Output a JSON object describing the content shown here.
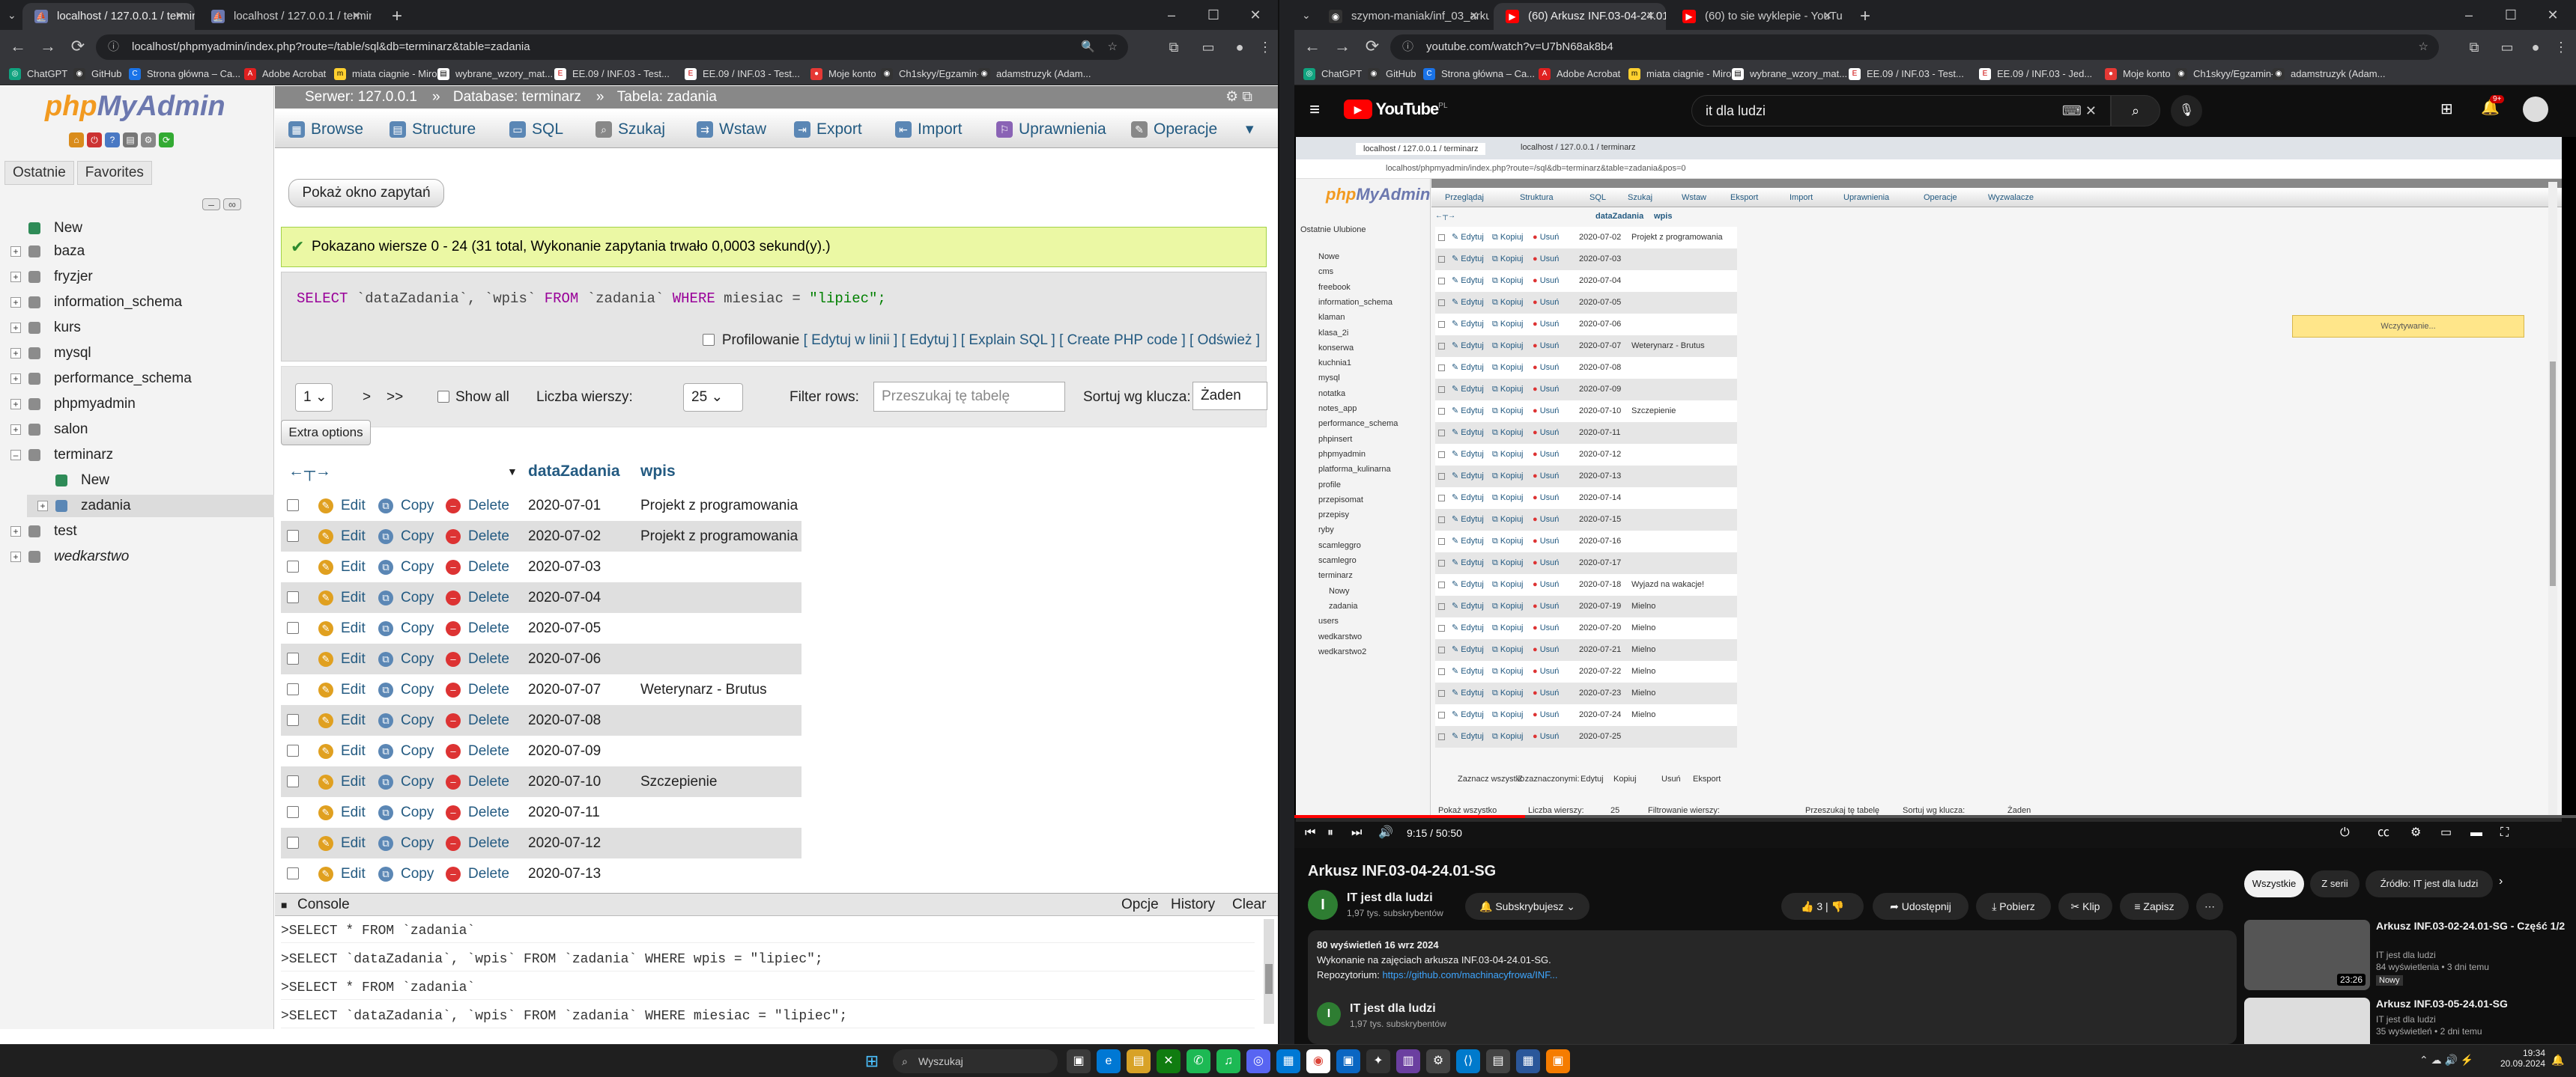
{
  "left_browser": {
    "tabs": [
      {
        "title": "localhost / 127.0.0.1 / terminarz"
      },
      {
        "title": "localhost / 127.0.0.1 / terminarz"
      }
    ],
    "url": "localhost/phpmyadmin/index.php?route=/table/sql&db=terminarz&table=zadania",
    "bookmarks": [
      "ChatGPT",
      "GitHub",
      "Strona główna – Ca...",
      "Adobe Acrobat",
      "miata ciagnie - Miro",
      "wybrane_wzory_mat...",
      "EE.09 / INF.03 - Test...",
      "EE.09 / INF.03 - Test...",
      "Moje konto",
      "Ch1skyy/Egzamin-...",
      "adamstruzyk (Adam..."
    ]
  },
  "pma": {
    "logo_php": "php",
    "logo_myadmin": "MyAdmin",
    "nav_tabs": [
      "Ostatnie",
      "Favorites"
    ],
    "tree": [
      "New",
      "baza",
      "fryzjer",
      "information_schema",
      "kurs",
      "mysql",
      "performance_schema",
      "phpmyadmin",
      "salon",
      "terminarz",
      "New",
      "zadania",
      "test",
      "wedkarstwo"
    ],
    "breadcrumb": {
      "server": "Serwer: 127.0.0.1",
      "database": "Database: terminarz",
      "table": "Tabela: zadania"
    },
    "tabs": [
      "Browse",
      "Structure",
      "SQL",
      "Szukaj",
      "Wstaw",
      "Export",
      "Import",
      "Uprawnienia",
      "Operacje"
    ],
    "query_window_button": "Pokaż okno zapytań",
    "success_message": "Pokazano wiersze 0 - 24 (31 total, Wykonanie zapytania trwało 0,0003 sekund(y).)",
    "sql": {
      "select": "SELECT",
      "cols": "`dataZadania`, `wpis`",
      "from": "FROM",
      "table": "`zadania`",
      "where": "WHERE",
      "cond": "miesiac = ",
      "val": "\"lipiec\";"
    },
    "profiling": "Profilowanie",
    "sql_links": [
      "Edytuj w linii",
      "Edytuj",
      "Explain SQL",
      "Create PHP code",
      "Odśwież"
    ],
    "nav": {
      "page": "1",
      "next": ">",
      "last": ">>",
      "show_all": "Show all",
      "rows_label": "Liczba wierszy:",
      "rows_value": "25",
      "filter_label": "Filter rows:",
      "filter_placeholder": "Przeszukaj tę tabelę",
      "sort_label": "Sortuj wg klucza:",
      "sort_value": "Żaden"
    },
    "extra_options": "Extra options",
    "columns": [
      "dataZadania",
      "wpis"
    ],
    "row_actions": {
      "edit": "Edit",
      "copy": "Copy",
      "delete": "Delete"
    },
    "rows": [
      {
        "date": "2020-07-01",
        "wpis": "Projekt z programowania"
      },
      {
        "date": "2020-07-02",
        "wpis": "Projekt z programowania"
      },
      {
        "date": "2020-07-03",
        "wpis": ""
      },
      {
        "date": "2020-07-04",
        "wpis": ""
      },
      {
        "date": "2020-07-05",
        "wpis": ""
      },
      {
        "date": "2020-07-06",
        "wpis": ""
      },
      {
        "date": "2020-07-07",
        "wpis": "Weterynarz - Brutus"
      },
      {
        "date": "2020-07-08",
        "wpis": ""
      },
      {
        "date": "2020-07-09",
        "wpis": ""
      },
      {
        "date": "2020-07-10",
        "wpis": "Szczepienie"
      },
      {
        "date": "2020-07-11",
        "wpis": ""
      },
      {
        "date": "2020-07-12",
        "wpis": ""
      },
      {
        "date": "2020-07-13",
        "wpis": ""
      }
    ],
    "console": {
      "title": "Console",
      "actions": [
        "Opcje",
        "History",
        "Clear"
      ],
      "lines": [
        ">SELECT * FROM `zadania`",
        ">SELECT `dataZadania`, `wpis` FROM `zadania` WHERE wpis = \"lipiec\";",
        ">SELECT * FROM `zadania`",
        ">SELECT `dataZadania`, `wpis` FROM `zadania` WHERE miesiac = \"lipiec\";"
      ]
    }
  },
  "right_browser": {
    "tabs": [
      {
        "title": "szymon-maniak/inf_03_arkusze"
      },
      {
        "title": "(60) Arkusz INF.03-04-24.01-SG"
      },
      {
        "title": "(60) to sie wyklepie - YouTube"
      }
    ],
    "url": "youtube.com/watch?v=U7bN68ak8b4",
    "bookmarks": [
      "ChatGPT",
      "GitHub",
      "Strona główna – Ca...",
      "Adobe Acrobat",
      "miata ciagnie - Miro",
      "wybrane_wzory_mat...",
      "EE.09 / INF.03 - Test...",
      "EE.09 / INF.03 - Jed...",
      "Moje konto",
      "Ch1skyy/Egzamin-...",
      "adamstruzyk (Adam..."
    ]
  },
  "youtube": {
    "logo": "YouTube",
    "logo_region": "PL",
    "search_value": "it dla ludzi",
    "notifications": "9+",
    "video": {
      "inner_url": "localhost/phpmyadmin/index.php?route=/sql&db=terminarz&table=zadania&pos=0",
      "inner_tabs": [
        "localhost / 127.0.0.1 / terminarz",
        "localhost / 127.0.0.1 / terminarz"
      ],
      "inner_tree": [
        "Nowe",
        "cms",
        "freebook",
        "information_schema",
        "klaman",
        "klasa_2i",
        "konserwa",
        "kuchnia1",
        "mysql",
        "notatka",
        "notes_app",
        "performance_schema",
        "phpinsert",
        "phpmyadmin",
        "platforma_kulinarna",
        "profile",
        "przepisomat",
        "przepisy",
        "ryby",
        "scamleggro",
        "scamlegro",
        "terminarz",
        "Nowy",
        "zadania",
        "users",
        "wedkarstwo",
        "wedkarstwo2"
      ],
      "inner_tabs_main": [
        "Przeglądaj",
        "Struktura",
        "SQL",
        "Szukaj",
        "Wstaw",
        "Eksport",
        "Import",
        "Uprawnienia",
        "Operacje",
        "Wyzwalacze"
      ],
      "inner_cols": [
        "dataZadania",
        "wpis"
      ],
      "inner_actions": {
        "edit": "Edytuj",
        "copy": "Kopiuj",
        "delete": "Usuń"
      },
      "inner_rows": [
        {
          "d": "2020-07-02",
          "w": "Projekt z programowania"
        },
        {
          "d": "2020-07-03",
          "w": ""
        },
        {
          "d": "2020-07-04",
          "w": ""
        },
        {
          "d": "2020-07-05",
          "w": ""
        },
        {
          "d": "2020-07-06",
          "w": ""
        },
        {
          "d": "2020-07-07",
          "w": "Weterynarz - Brutus"
        },
        {
          "d": "2020-07-08",
          "w": ""
        },
        {
          "d": "2020-07-09",
          "w": ""
        },
        {
          "d": "2020-07-10",
          "w": "Szczepienie"
        },
        {
          "d": "2020-07-11",
          "w": ""
        },
        {
          "d": "2020-07-12",
          "w": ""
        },
        {
          "d": "2020-07-13",
          "w": ""
        },
        {
          "d": "2020-07-14",
          "w": ""
        },
        {
          "d": "2020-07-15",
          "w": ""
        },
        {
          "d": "2020-07-16",
          "w": ""
        },
        {
          "d": "2020-07-17",
          "w": ""
        },
        {
          "d": "2020-07-18",
          "w": "Wyjazd na wakacje!"
        },
        {
          "d": "2020-07-19",
          "w": "Mielno"
        },
        {
          "d": "2020-07-20",
          "w": "Mielno"
        },
        {
          "d": "2020-07-21",
          "w": "Mielno"
        },
        {
          "d": "2020-07-22",
          "w": "Mielno"
        },
        {
          "d": "2020-07-23",
          "w": "Mielno"
        },
        {
          "d": "2020-07-24",
          "w": "Mielno"
        },
        {
          "d": "2020-07-25",
          "w": ""
        }
      ],
      "loading": "Wczytywanie...",
      "inner_footer": [
        "Zaznacz wszystko",
        "Z zaznaczonymi:",
        "Edytuj",
        "Kopiuj",
        "Usuń",
        "Eksport"
      ],
      "inner_nav": [
        "Pokaż wszystko",
        "Liczba wierszy:",
        "25",
        "Filtrowanie wierszy:",
        "Przeszukaj tę tabelę",
        "Sortuj wg klucza:",
        "Żaden"
      ],
      "time": "9:15 / 50:50",
      "progress": 0.18
    },
    "title": "Arkusz INF.03-04-24.01-SG",
    "channel": "IT jest dla ludzi",
    "subscribers": "1,97 tys. subskrybentów",
    "subscribe_label": "Subskrybujesz",
    "likes": "3",
    "actions": [
      "Udostępnij",
      "Pobierz",
      "Klip",
      "Zapisz"
    ],
    "desc_stats": "80 wyświetleń  16 wrz 2024",
    "desc_line": "Wykonanie na zajęciach arkusza INF.03-04-24.01-SG.",
    "desc_repo_label": "Repozytorium:",
    "desc_repo_link": "https://github.com/machinacyfrowa/INF...",
    "desc_channel": "IT jest dla ludzi",
    "desc_subs": "1,97 tys. subskrybentów",
    "chips": [
      "Wszystkie",
      "Z serii",
      "Źródło: IT jest dla ludzi"
    ],
    "related": [
      {
        "title": "Arkusz INF.03-02-24.01-SG - Część 1/2",
        "channel": "IT jest dla ludzi",
        "meta": "84 wyświetlenia • 3 dni temu",
        "badge": "Nowy",
        "duration": "23:26"
      },
      {
        "title": "Arkusz INF.03-05-24.01-SG",
        "channel": "IT jest dla ludzi",
        "meta": "35 wyświetleń • 2 dni temu",
        "badge": "",
        "duration": ""
      }
    ]
  },
  "taskbar": {
    "search_placeholder": "Wyszukaj",
    "time": "19:34",
    "date": "20.09.2024"
  },
  "colors": {
    "pma_link": "#235a81",
    "pma_success_bg": "#ebf8a4",
    "youtube_red": "#ff0000",
    "chrome_dark": "#202124"
  }
}
